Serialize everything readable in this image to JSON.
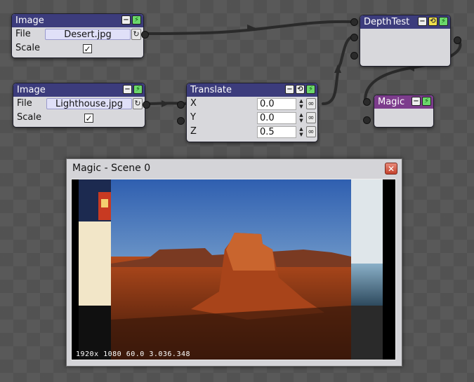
{
  "nodes": {
    "image1": {
      "title": "Image",
      "file_label": "File",
      "file_value": "Desert.jpg",
      "scale_label": "Scale",
      "scale_checked": "✓"
    },
    "image2": {
      "title": "Image",
      "file_label": "File",
      "file_value": "Lighthouse.jpg",
      "scale_label": "Scale",
      "scale_checked": "✓"
    },
    "translate": {
      "title": "Translate",
      "x_label": "X",
      "x_value": "0.0",
      "y_label": "Y",
      "y_value": "0.0",
      "z_label": "Z",
      "z_value": "0.5"
    },
    "depthtest": {
      "title": "DepthTest"
    },
    "magic": {
      "title": "Magic"
    }
  },
  "window": {
    "title": "Magic - Scene 0",
    "close_glyph": "✕",
    "stats": "1920x 1080  60.0  3.036.348"
  },
  "icons": {
    "minimize": "−",
    "run": "⚡",
    "link": "⟲",
    "reload": "↻",
    "chain": "∞",
    "spin_up": "▲",
    "spin_down": "▼"
  },
  "colors": {
    "header_blue": "#3c3c7c",
    "header_magic": "#7c3c8c",
    "run_green": "#6cd86c",
    "link_yellow": "#f0e04c"
  }
}
